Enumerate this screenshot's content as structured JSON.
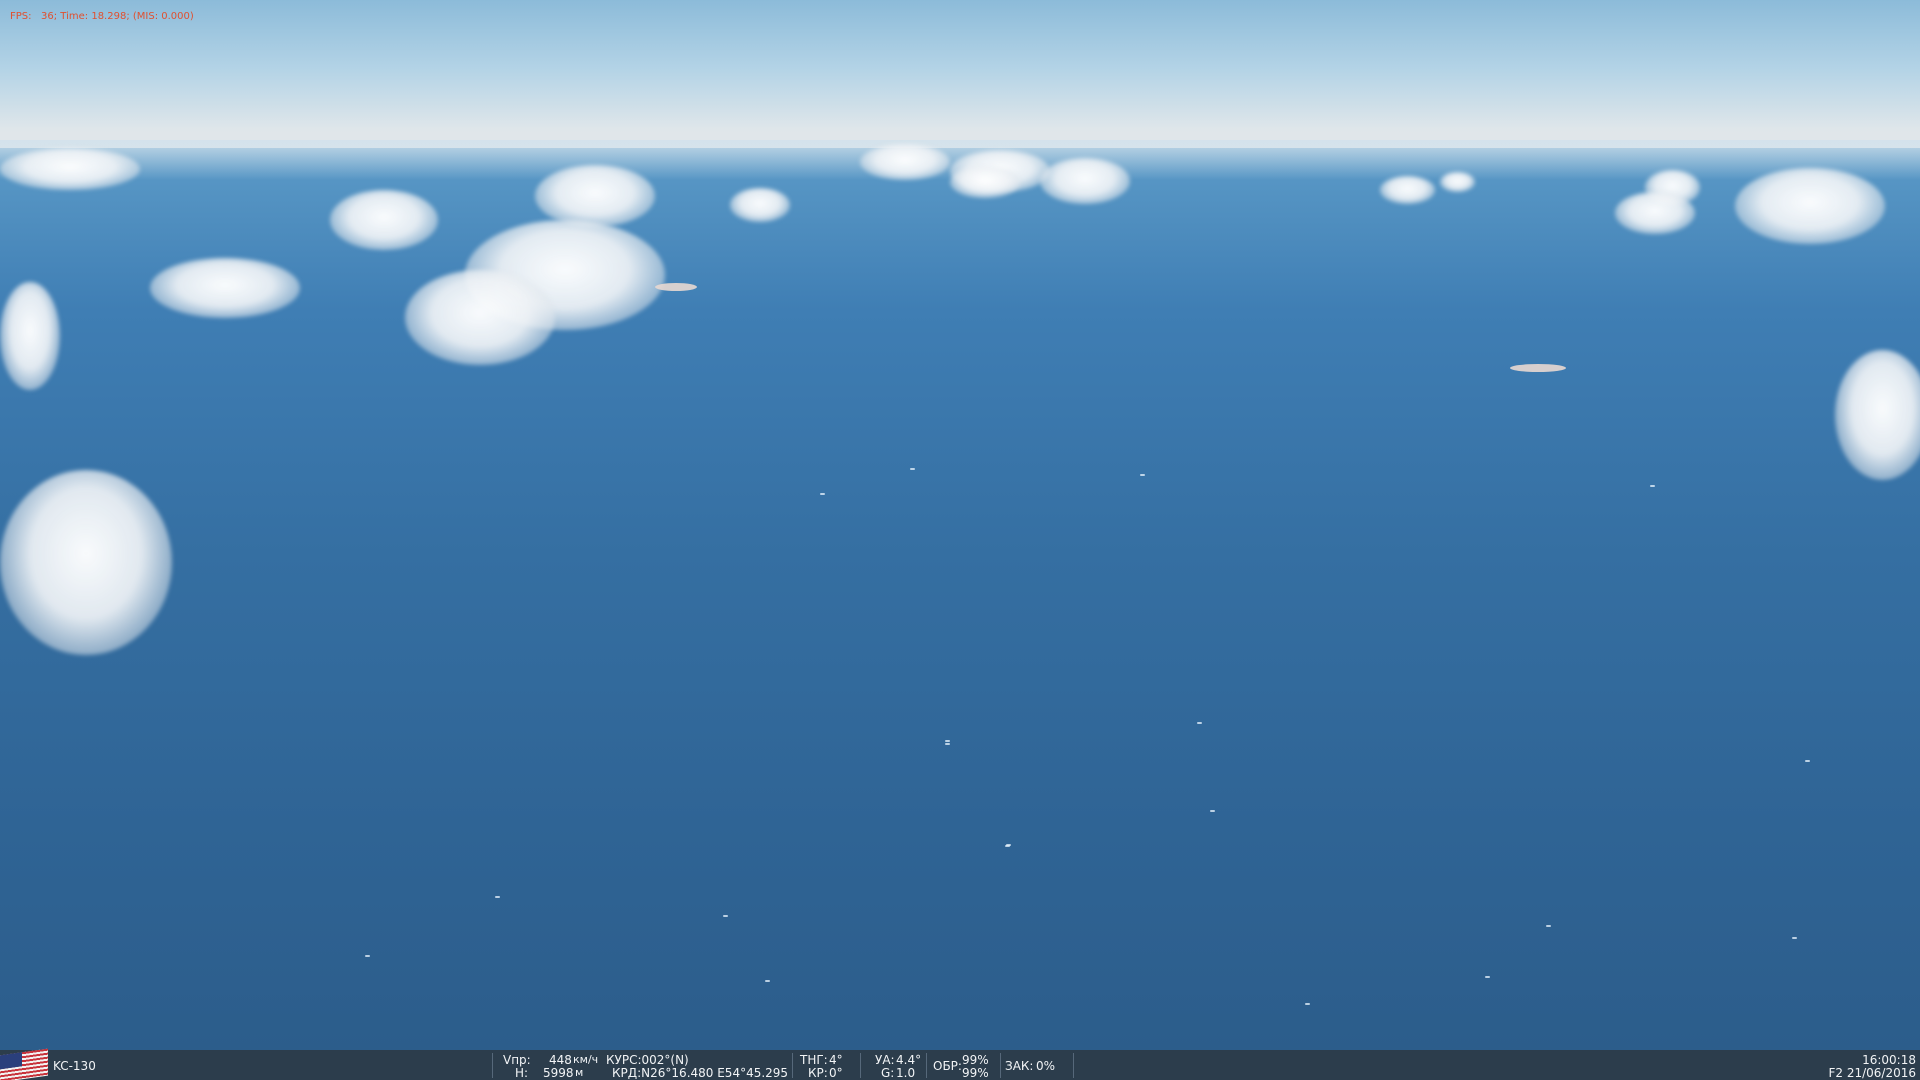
{
  "debug": {
    "text": "FPS:   36; Time: 18.298; (MIS: 0.000)",
    "color": "#e0502f"
  },
  "hud": {
    "flag_icon": "usa-flag-icon",
    "aircraft": "KC-130",
    "vpr_label": "Vпр:",
    "vpr_value": "448",
    "vpr_unit": "км/ч",
    "h_label": "H:",
    "h_value": "5998",
    "h_unit": "м",
    "heading": "КУРС:002°(N)",
    "coords": "КРД:N26°16.480 E54°45.295",
    "pitch_label": "ТНГ:",
    "pitch_value": "4°",
    "roll_label": "КР:",
    "roll_value": "0°",
    "aoa_label": "УА:",
    "aoa_value": "4.4°",
    "g_label": "G:",
    "g_value": "1.0",
    "rpm_label": "ОБР:",
    "rpm_value_1": "99%",
    "rpm_value_2": "99%",
    "flaps_label": "ЗАК:",
    "flaps_value": "0%",
    "time": "16:00:18",
    "date": "F2 21/06/2016"
  },
  "colors": {
    "hud_background": "#2c3d4c",
    "sea": "#2f6899",
    "sky": "#b3d3e6"
  }
}
